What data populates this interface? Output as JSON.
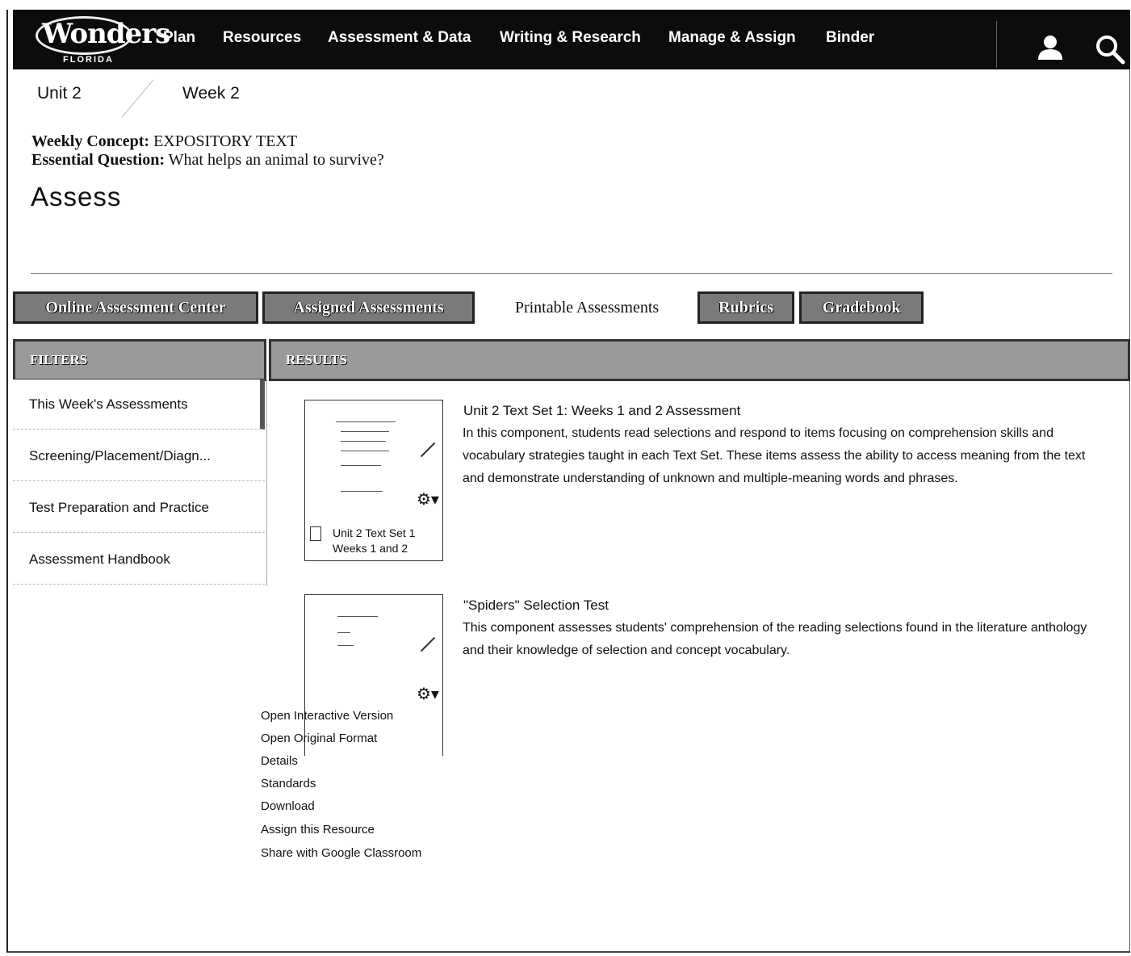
{
  "nav": {
    "logo_text": "Wonders",
    "logo_sub": "FLORIDA",
    "items": [
      "Plan",
      "Resources",
      "Assessment & Data",
      "Writing & Research",
      "Manage & Assign",
      "Binder"
    ],
    "user_icon": "user-icon",
    "search_icon": "search-icon"
  },
  "breadcrumb": {
    "unit": "Unit 2",
    "week": "Week 2"
  },
  "concept": {
    "concept_label": "Weekly Concept:",
    "concept_value": "EXPOSITORY TEXT",
    "question_label": "Essential Question:",
    "question_value": "What helps an animal to survive?"
  },
  "page_title": "Assess",
  "tabs": [
    "Online Assessment Center",
    "Assigned Assessments",
    "Printable Assessments",
    "Rubrics",
    "Gradebook"
  ],
  "active_tab": "Printable Assessments",
  "filters": {
    "header": "FILTERS",
    "items": [
      "This Week's Assessments",
      "Screening/Placement/Diagn...",
      "Test Preparation and Practice",
      "Assessment Handbook"
    ]
  },
  "results": {
    "header": "RESULTS",
    "items": [
      {
        "card_title_line1": "Unit 2 Text Set 1",
        "card_title_line2": "Weeks 1 and 2",
        "title": "Unit 2 Text Set 1: Weeks 1 and 2 Assessment",
        "description": "In this component, students read selections and respond to items focusing on comprehension skills and vocabulary strategies taught in each Text Set. These items assess the ability to access meaning from the text and demonstrate understanding of unknown and multiple-meaning words and phrases."
      },
      {
        "title": "\"Spiders\" Selection Test",
        "description": "This component assesses students' comprehension of the reading selections found in the literature anthology and their knowledge of selection and concept vocabulary."
      }
    ]
  },
  "menu": [
    "Open Interactive Version",
    "Open Original Format",
    "Details",
    "Standards",
    "Download",
    "Assign this Resource",
    "Share with Google Classroom"
  ]
}
